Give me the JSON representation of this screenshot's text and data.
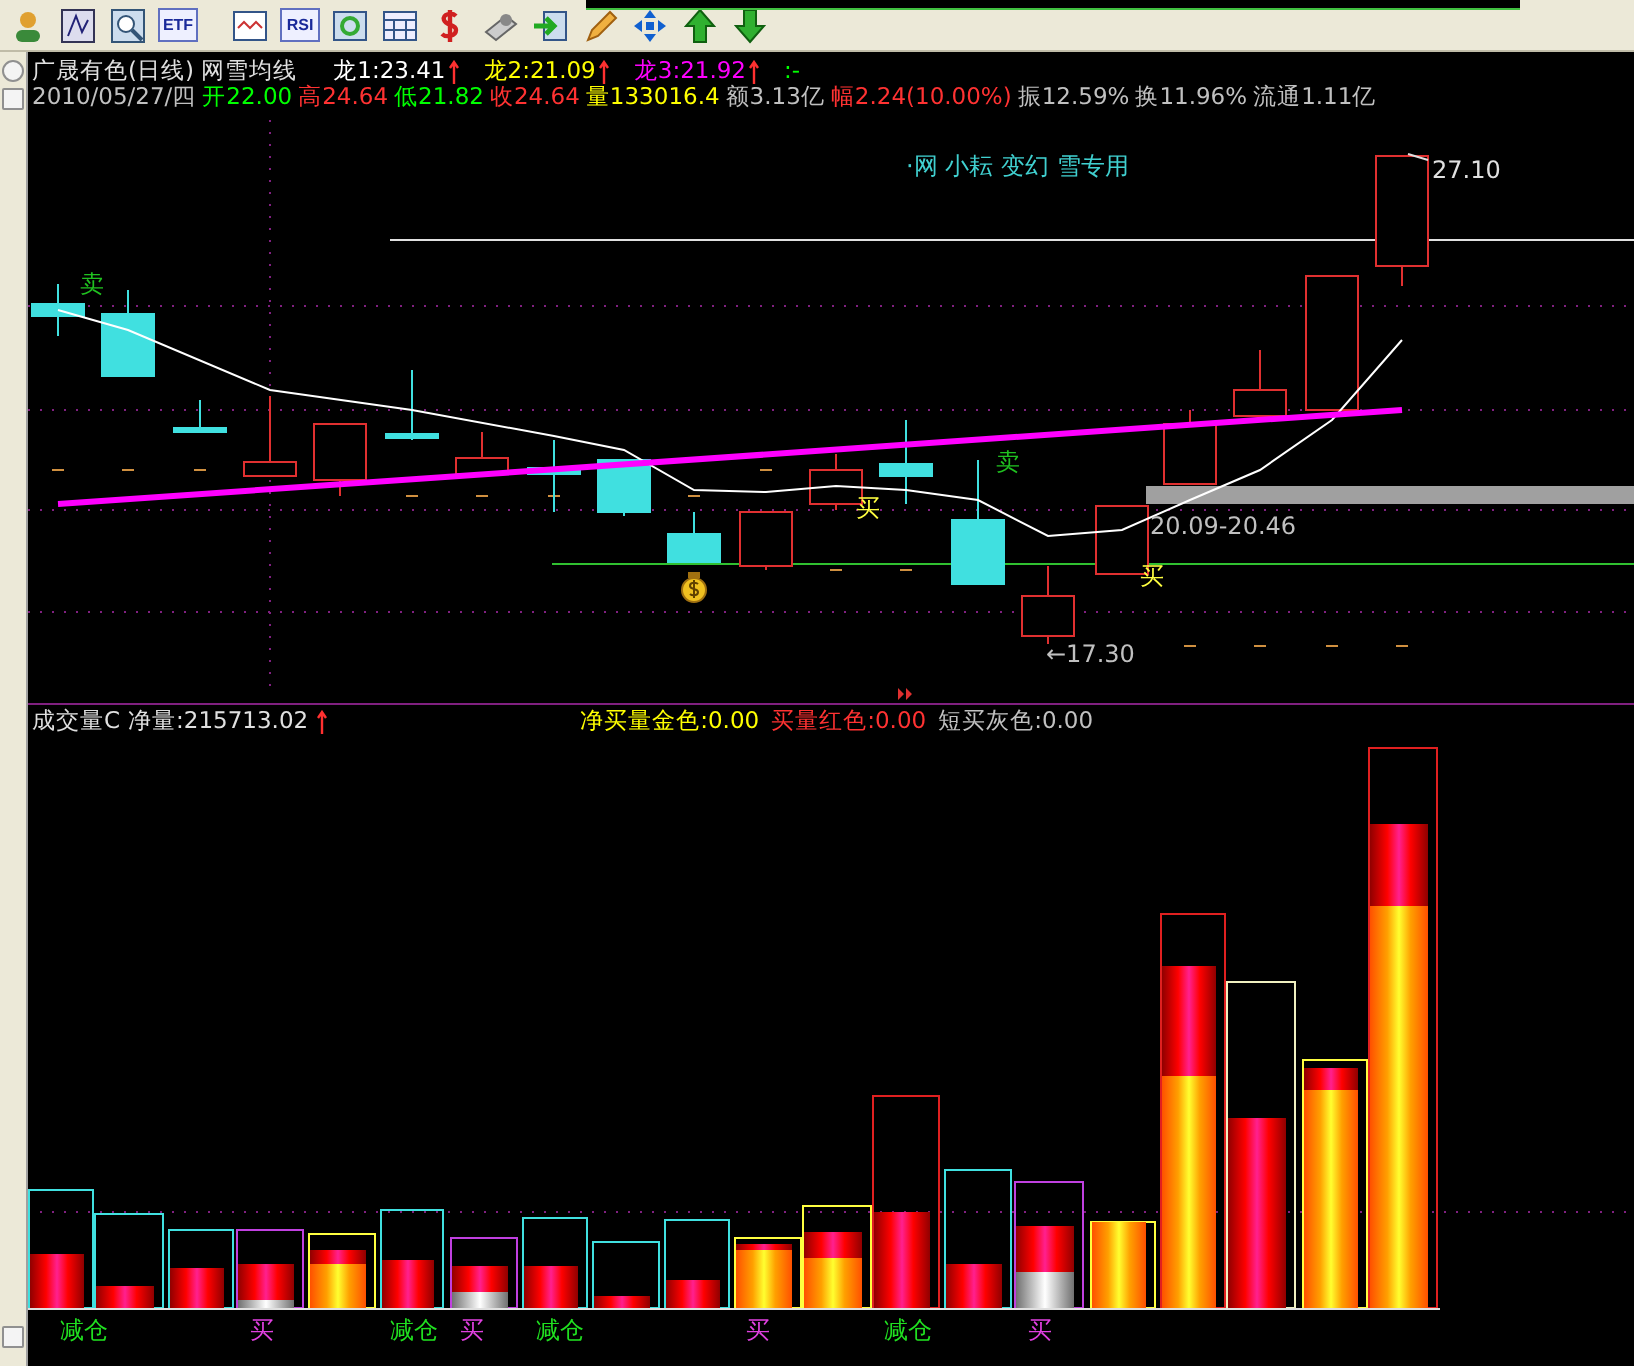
{
  "toolbar": [
    {
      "kind": "user"
    },
    {
      "kind": "formula"
    },
    {
      "kind": "search"
    },
    {
      "kind": "label",
      "label": "ETF"
    },
    {
      "kind": "wave"
    },
    {
      "kind": "label",
      "label": "RSI"
    },
    {
      "kind": "refresh"
    },
    {
      "kind": "grid"
    },
    {
      "kind": "money"
    },
    {
      "kind": "disk"
    },
    {
      "kind": "exit"
    },
    {
      "kind": "pencil"
    },
    {
      "kind": "move"
    },
    {
      "kind": "up"
    },
    {
      "kind": "down"
    }
  ],
  "header": {
    "title": "广晟有色(日线) 网雪均线",
    "indicators": [
      {
        "label": "龙1:23.41",
        "color": "#ffffff",
        "arrow": true
      },
      {
        "label": "龙2:21.09",
        "color": "#ffff00",
        "arrow": true
      },
      {
        "label": "龙3:21.92",
        "color": "#ff00ff",
        "arrow": true
      },
      {
        "label": ":-",
        "color": "#00ff00",
        "arrow": false
      }
    ],
    "quote": [
      {
        "text": "2010/05/27/四",
        "color": "#c0c0c0"
      },
      {
        "text": "开22.00",
        "color": "#00ff00"
      },
      {
        "text": "高24.64",
        "color": "#ff3232"
      },
      {
        "text": "低21.82",
        "color": "#00ff00"
      },
      {
        "text": "收24.64",
        "color": "#ff3232"
      },
      {
        "text": "量133016.4",
        "color": "#ffff00"
      },
      {
        "text": "额3.13亿",
        "color": "#c0c0c0"
      },
      {
        "text": "幅2.24(10.00%)",
        "color": "#ff3232"
      },
      {
        "text": "振12.59%",
        "color": "#c0c0c0"
      },
      {
        "text": "换11.96%",
        "color": "#c0c0c0"
      },
      {
        "text": "流通1.11亿",
        "color": "#c0c0c0"
      }
    ]
  },
  "price_chart": {
    "caption": "·网 小耘 变幻 雪专用",
    "high_label": "27.10",
    "range_label": "20.09-20.46",
    "low_label": "←17.30",
    "signals": [
      {
        "kind": "sell",
        "text": "卖"
      },
      {
        "kind": "buy",
        "text": "买"
      },
      {
        "kind": "sell",
        "text": "卖"
      },
      {
        "kind": "buy",
        "text": "买"
      }
    ]
  },
  "volume_panel": {
    "title": "成交量C",
    "net": "净量:215713.02",
    "net_arrow": true,
    "legend": [
      {
        "text": "净买量金色:0.00",
        "color": "#ffff00"
      },
      {
        "text": "买量红色:0.00",
        "color": "#ff3232"
      },
      {
        "text": "短买灰色:0.00",
        "color": "#c0c0c0"
      }
    ],
    "markers": [
      {
        "kind": "reduce",
        "text": "减仓"
      },
      {
        "kind": "buy",
        "text": "买"
      },
      {
        "kind": "reduce",
        "text": "减仓"
      },
      {
        "kind": "buy",
        "text": "买"
      },
      {
        "kind": "reduce",
        "text": "减仓"
      },
      {
        "kind": "buy",
        "text": "买"
      },
      {
        "kind": "reduce",
        "text": "减仓"
      },
      {
        "kind": "buy",
        "text": "买"
      }
    ]
  }
}
